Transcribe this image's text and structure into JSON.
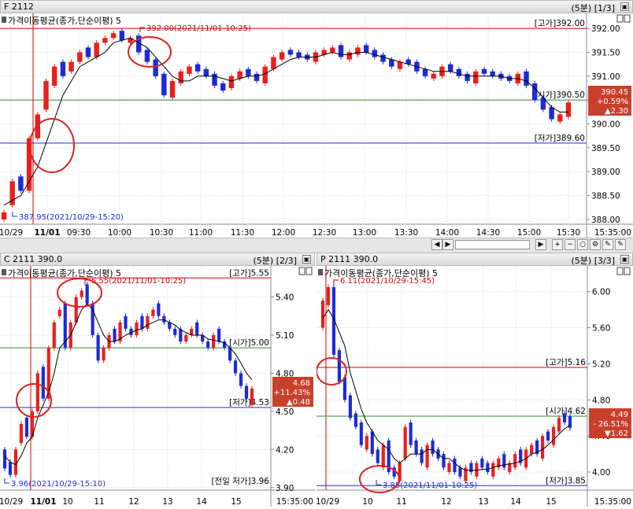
{
  "panels": [
    {
      "id": "F",
      "title": "F 2112",
      "right_label": "(5분) [1/3]",
      "indicator": "가격이동평균(종가,단순이평) 5",
      "y_ticks": [
        "392.00",
        "391.50",
        "391.00",
        "390.50",
        "390.00",
        "389.50",
        "389.00",
        "388.50",
        "388.00"
      ],
      "x_ticks": [
        "10/29",
        "11/01",
        "09:30",
        "10:00",
        "10:30",
        "11:00",
        "11:30",
        "12:00",
        "12:30",
        "13:00",
        "13:30",
        "14:00",
        "14:30",
        "15:00",
        "15:30",
        "15:35:00"
      ],
      "high_label": "[고가]392.00",
      "open_label": "[시가]390.50",
      "low_label": "[저가]389.60",
      "max_annot": "392.00(2021/11/01-10:25)",
      "min_annot": "387.95(2021/10/29-15:20)",
      "badge": {
        "price": "390.45",
        "pct": "+0.59%",
        "chg": "▲2.30"
      }
    },
    {
      "id": "C",
      "title": "C 2111 390.0",
      "right_label": "(5분) [2/3]",
      "indicator": "가격이동평균(종가,단순이평) 5",
      "y_ticks": [
        "5.40",
        "5.10",
        "4.80",
        "4.50",
        "4.20",
        "3.90"
      ],
      "x_ticks": [
        "10/29",
        "11/01",
        "10",
        "11",
        "12",
        "13",
        "14",
        "15",
        "15:35:00"
      ],
      "high_label": "[고가]5.55",
      "open_label": "[시가]5.00",
      "low_label": "[저가]4.53",
      "prev_low_label": "[전일 저가]3.96",
      "max_annot": "5.55(2021/11/01-10:25)",
      "min_annot": "3.96(2021/10/29-15:10)",
      "badge": {
        "price": "4.68",
        "pct": "+11.43%",
        "chg": "▲0.48"
      }
    },
    {
      "id": "P",
      "title": "P 2111 390.0",
      "right_label": "(5분) [3/3]",
      "indicator": "가격이동평균(종가,단순이평) 5",
      "y_ticks": [
        "6.00",
        "5.60",
        "5.20",
        "4.80",
        "4.40",
        "4.00"
      ],
      "x_ticks": [
        "10/29",
        "10",
        "11",
        "12",
        "13",
        "14",
        "15",
        "15:35:00"
      ],
      "high_label": "[고가]5.16",
      "open_label": "[시가]4.62",
      "low_label": "[저가]3.85",
      "max_annot": "6.11(2021/10/29-15:45)",
      "min_annot": "3.85(2021/11/01-10:25)",
      "badge": {
        "price": "4.49",
        "pct": "- 26.51%",
        "chg": "▼1.62"
      }
    }
  ],
  "colors": {
    "up": "#e8201c",
    "down": "#1c2bd6",
    "high_line": "#d40000",
    "open_line": "#2f8f2f",
    "low_line": "#1c2bd6",
    "ma_line": "#000000",
    "badge": "#c8402c"
  },
  "chart_data": [
    {
      "type": "candlestick",
      "title": "F 2112",
      "ylim": [
        387.9,
        392.2
      ],
      "close": [
        388.15,
        388.8,
        388.6,
        389.7,
        390.2,
        390.9,
        391.2,
        391.0,
        391.3,
        391.5,
        391.4,
        391.7,
        391.8,
        391.9,
        391.75,
        391.8,
        391.5,
        391.3,
        391.0,
        390.6,
        390.9,
        391.1,
        391.2,
        391.1,
        391.0,
        390.8,
        390.7,
        391.0,
        391.1,
        391.0,
        390.9,
        391.2,
        391.4,
        391.5,
        391.45,
        391.4,
        391.35,
        391.5,
        391.55,
        391.6,
        391.4,
        391.5,
        391.6,
        391.5,
        391.4,
        391.3,
        391.2,
        391.3,
        391.25,
        391.1,
        391.0,
        391.05,
        391.2,
        391.1,
        391.0,
        390.9,
        391.1,
        391.05,
        391.0,
        390.95,
        390.9,
        391.05,
        390.8,
        390.5,
        390.3,
        390.1,
        390.2,
        390.45
      ],
      "open": [
        388.0,
        388.3,
        388.9,
        388.6,
        389.7,
        390.3,
        390.8,
        391.3,
        391.1,
        391.3,
        391.6,
        391.4,
        391.7,
        391.8,
        391.95,
        391.7,
        391.85,
        391.55,
        391.35,
        391.05,
        390.55,
        390.85,
        391.05,
        391.25,
        391.15,
        391.05,
        390.85,
        390.75,
        390.95,
        391.15,
        391.05,
        390.85,
        391.15,
        391.35,
        391.55,
        391.5,
        391.45,
        391.3,
        391.45,
        391.5,
        391.65,
        391.35,
        391.45,
        391.65,
        391.55,
        391.45,
        391.35,
        391.15,
        391.35,
        391.3,
        391.15,
        390.95,
        391.0,
        391.25,
        391.15,
        391.05,
        390.85,
        391.15,
        391.1,
        391.05,
        391.0,
        390.85,
        391.1,
        390.85,
        390.55,
        390.35,
        390.05,
        390.15
      ],
      "ma5": [
        388.3,
        388.4,
        388.5,
        388.8,
        389.1,
        389.6,
        390.1,
        390.6,
        390.9,
        391.2,
        391.3,
        391.4,
        391.5,
        391.7,
        391.75,
        391.8,
        391.7,
        391.6,
        391.4,
        391.2,
        391.0,
        390.9,
        390.9,
        391.0,
        391.0,
        391.0,
        390.95,
        390.9,
        390.95,
        391.0,
        391.0,
        391.05,
        391.15,
        391.25,
        391.35,
        391.4,
        391.4,
        391.4,
        391.45,
        391.5,
        391.45,
        391.45,
        391.5,
        391.5,
        391.45,
        391.4,
        391.35,
        391.3,
        391.25,
        391.2,
        391.15,
        391.1,
        391.1,
        391.1,
        391.05,
        391.0,
        391.0,
        391.0,
        391.0,
        391.0,
        390.95,
        390.95,
        390.9,
        390.75,
        390.55,
        390.35,
        390.25,
        390.25
      ],
      "annotations": [
        "392.00(2021/11/01-10:25)",
        "387.95(2021/10/29-15:20)"
      ]
    },
    {
      "type": "candlestick",
      "title": "C 2111 390.0",
      "ylim": [
        3.88,
        5.62
      ],
      "close": [
        4.05,
        4.0,
        4.2,
        4.4,
        4.3,
        4.5,
        4.8,
        4.6,
        5.0,
        5.2,
        5.3,
        5.0,
        5.2,
        5.4,
        5.45,
        5.35,
        5.1,
        4.9,
        5.0,
        5.1,
        5.05,
        5.2,
        5.15,
        5.1,
        5.2,
        5.15,
        5.25,
        5.3,
        5.25,
        5.2,
        5.15,
        5.1,
        5.05,
        5.1,
        5.15,
        5.1,
        5.05,
        5.0,
        5.1,
        5.05,
        5.0,
        4.9,
        4.8,
        4.7,
        4.6,
        4.68
      ],
      "open": [
        4.2,
        4.1,
        4.0,
        4.25,
        4.45,
        4.3,
        4.5,
        4.85,
        4.6,
        5.0,
        5.25,
        5.35,
        5.0,
        5.2,
        5.4,
        5.5,
        5.35,
        5.1,
        4.9,
        5.0,
        5.15,
        5.05,
        5.25,
        5.15,
        5.1,
        5.25,
        5.15,
        5.25,
        5.35,
        5.25,
        5.2,
        5.15,
        5.15,
        5.05,
        5.1,
        5.2,
        5.1,
        5.05,
        5.0,
        5.15,
        5.05,
        5.0,
        4.9,
        4.8,
        4.7,
        4.55
      ],
      "ma5": [
        4.15,
        4.1,
        4.08,
        4.15,
        4.25,
        4.3,
        4.45,
        4.55,
        4.65,
        4.8,
        5.0,
        5.05,
        5.1,
        5.2,
        5.3,
        5.35,
        5.3,
        5.2,
        5.1,
        5.05,
        5.05,
        5.07,
        5.1,
        5.12,
        5.14,
        5.15,
        5.18,
        5.2,
        5.22,
        5.22,
        5.2,
        5.18,
        5.14,
        5.12,
        5.1,
        5.1,
        5.1,
        5.07,
        5.06,
        5.05,
        5.04,
        5.0,
        4.95,
        4.88,
        4.8,
        4.75
      ],
      "annotations": [
        "5.55(2021/11/01-10:25)",
        "3.96(2021/10/29-15:10)"
      ]
    },
    {
      "type": "candlestick",
      "title": "P 2111 390.0",
      "ylim": [
        3.8,
        6.25
      ],
      "close": [
        5.9,
        6.05,
        5.3,
        5.0,
        4.8,
        4.6,
        4.5,
        4.3,
        4.4,
        4.2,
        4.1,
        4.3,
        4.0,
        3.95,
        4.1,
        4.5,
        4.3,
        4.2,
        4.1,
        4.3,
        4.2,
        4.15,
        4.05,
        4.1,
        4.0,
        3.95,
        4.05,
        4.0,
        4.1,
        4.05,
        4.0,
        4.1,
        4.15,
        4.05,
        4.1,
        4.2,
        4.1,
        4.25,
        4.3,
        4.2,
        4.4,
        4.35,
        4.5,
        4.6,
        4.55,
        4.49
      ],
      "open": [
        5.6,
        5.85,
        6.05,
        5.35,
        5.05,
        4.85,
        4.65,
        4.55,
        4.25,
        4.45,
        4.25,
        4.05,
        4.35,
        4.05,
        3.9,
        4.15,
        4.55,
        4.35,
        4.25,
        4.05,
        4.35,
        4.25,
        4.2,
        4.0,
        4.15,
        4.05,
        3.9,
        4.1,
        3.95,
        4.15,
        4.1,
        3.95,
        4.05,
        4.2,
        4.0,
        4.05,
        4.25,
        4.05,
        4.2,
        4.35,
        4.15,
        4.45,
        4.3,
        4.45,
        4.65,
        4.62
      ],
      "ma5": [
        5.7,
        5.8,
        5.7,
        5.55,
        5.4,
        5.1,
        4.9,
        4.7,
        4.55,
        4.45,
        4.35,
        4.3,
        4.25,
        4.15,
        4.1,
        4.15,
        4.2,
        4.2,
        4.2,
        4.25,
        4.25,
        4.2,
        4.15,
        4.15,
        4.1,
        4.05,
        4.02,
        4.02,
        4.02,
        4.03,
        4.03,
        4.05,
        4.07,
        4.08,
        4.09,
        4.1,
        4.12,
        4.15,
        4.2,
        4.22,
        4.25,
        4.3,
        4.36,
        4.42,
        4.48,
        4.52
      ],
      "annotations": [
        "6.11(2021/10/29-15:45)",
        "3.85(2021/11/01-10:25)"
      ]
    }
  ]
}
